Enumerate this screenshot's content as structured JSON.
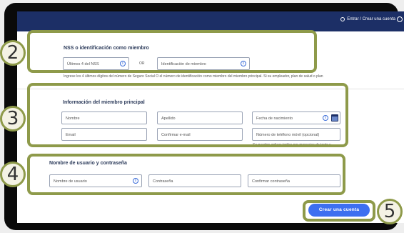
{
  "header": {
    "signin_label": "Entrar / Crear una cuenta"
  },
  "nss": {
    "title": "NSS o identificación como miembro",
    "ssn_placeholder": "Últimos 4 del NSS",
    "or_label": "OR",
    "member_id_placeholder": "Identificación de miembro",
    "help": "Ingrese los 4 últimos dígitos del número de Seguro Social O el número de identificación como miembro del miembro principal. Si su empleador, plan de salud o plan"
  },
  "member": {
    "title": "Información del miembro principal",
    "first_name": "Nombre",
    "last_name": "Apellido",
    "dob": "Fecha de nacimiento",
    "email": "Email",
    "confirm_email": "Confirmar e-mail",
    "phone": "Número de teléfono móvil (opcional)",
    "sms_note": "Se pueden aplicar tarifas por mensajes de texto y"
  },
  "credentials": {
    "title": "Nombre de usuario y contraseña",
    "username": "Nombre de usuario",
    "password": "Contraseña",
    "confirm_password": "Confirmar contraseña"
  },
  "actions": {
    "create_account": "Crear una cuenta"
  },
  "badges": {
    "b2": "2",
    "b3": "3",
    "b4": "4",
    "b5": "5"
  },
  "colors": {
    "highlight": "#8e9a4a",
    "primary": "#3d6ff0",
    "header": "#1c2f66"
  }
}
